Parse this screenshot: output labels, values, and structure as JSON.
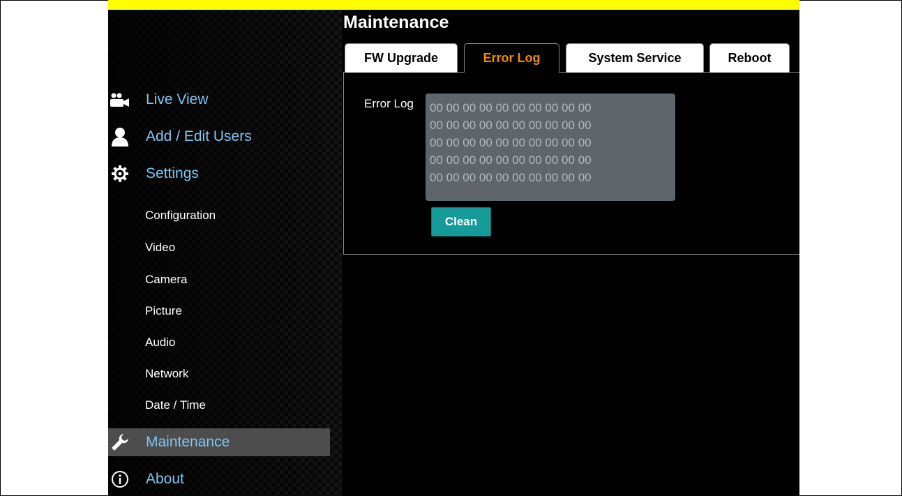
{
  "page": {
    "title": "Maintenance"
  },
  "tabs": [
    {
      "label": "FW Upgrade"
    },
    {
      "label": "Error Log"
    },
    {
      "label": "System Service"
    },
    {
      "label": "Reboot"
    }
  ],
  "active_tab": "Error Log",
  "sidebar": {
    "main_items": [
      {
        "label": "Live View",
        "icon": "video-camera-icon"
      },
      {
        "label": "Add / Edit Users",
        "icon": "user-icon"
      },
      {
        "label": "Settings",
        "icon": "gear-icon"
      },
      {
        "label": "Maintenance",
        "icon": "wrench-icon"
      },
      {
        "label": "About",
        "icon": "info-icon"
      }
    ],
    "sub_items": [
      {
        "label": "Configuration"
      },
      {
        "label": "Video"
      },
      {
        "label": "Camera"
      },
      {
        "label": "Picture"
      },
      {
        "label": "Audio"
      },
      {
        "label": "Network"
      },
      {
        "label": "Date / Time"
      }
    ],
    "active_item": "Maintenance"
  },
  "error_log": {
    "label": "Error Log",
    "lines": [
      "00 00 00 00 00 00 00 00 00 00",
      "00 00 00 00 00 00 00 00 00 00",
      "00 00 00 00 00 00 00 00 00 00",
      "00 00 00 00 00 00 00 00 00 00",
      "00 00 00 00 00 00 00 00 00 00"
    ],
    "clean_label": "Clean"
  },
  "colors": {
    "nav_link": "#7fc6f2",
    "active_tab_text": "#f08c00",
    "clean_button": "#169b9b",
    "log_box": "#5e666c",
    "top_strip": "#ffff00"
  }
}
